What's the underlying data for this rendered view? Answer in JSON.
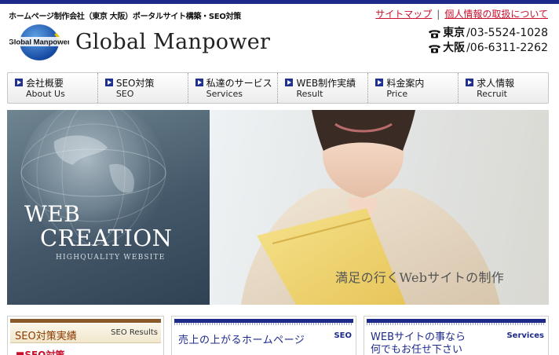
{
  "header": {
    "tagline": "ホームページ制作会社（東京 大阪）ポータルサイト構築・SEO対策",
    "links": {
      "sitemap": "サイトマップ",
      "separator": "|",
      "privacy": "個人情報の取扱について"
    },
    "brand": "Global Manpower",
    "logo_text": "Global Manpower",
    "phones": [
      {
        "icon": "telephone-icon",
        "city": "東京",
        "number": "/03-5524-1028"
      },
      {
        "icon": "telephone-icon",
        "city": "大阪",
        "number": "/06-6311-2262"
      }
    ]
  },
  "nav": {
    "items": [
      {
        "jp": "会社概要",
        "en": "About Us"
      },
      {
        "jp": "SEO対策",
        "en": "SEO"
      },
      {
        "jp": "私達のサービス",
        "en": "Services"
      },
      {
        "jp": "WEB制作実績",
        "en": "Result"
      },
      {
        "jp": "料金案内",
        "en": "Price"
      },
      {
        "jp": "求人情報",
        "en": "Recruit"
      }
    ]
  },
  "hero": {
    "line1": "WEB",
    "line2": "CREATION",
    "subtitle": "HIGHQUALITY  WEBSITE",
    "caption": "満足の行くWebサイトの制作"
  },
  "panels": {
    "left": {
      "title": "SEO対策実績",
      "tag": "SEO Results",
      "sub": "■SEO対策"
    },
    "middle": {
      "title": "売上の上がるホームページ",
      "tag": "SEO"
    },
    "right": {
      "title_line1": "WEBサイトの事なら",
      "title_line2": "何でもお任せ下さい",
      "tag": "Services"
    }
  },
  "colors": {
    "brand_navy": "#1d2a8a",
    "link_red": "#c8102e",
    "seo_brown": "#8b5a2b"
  }
}
